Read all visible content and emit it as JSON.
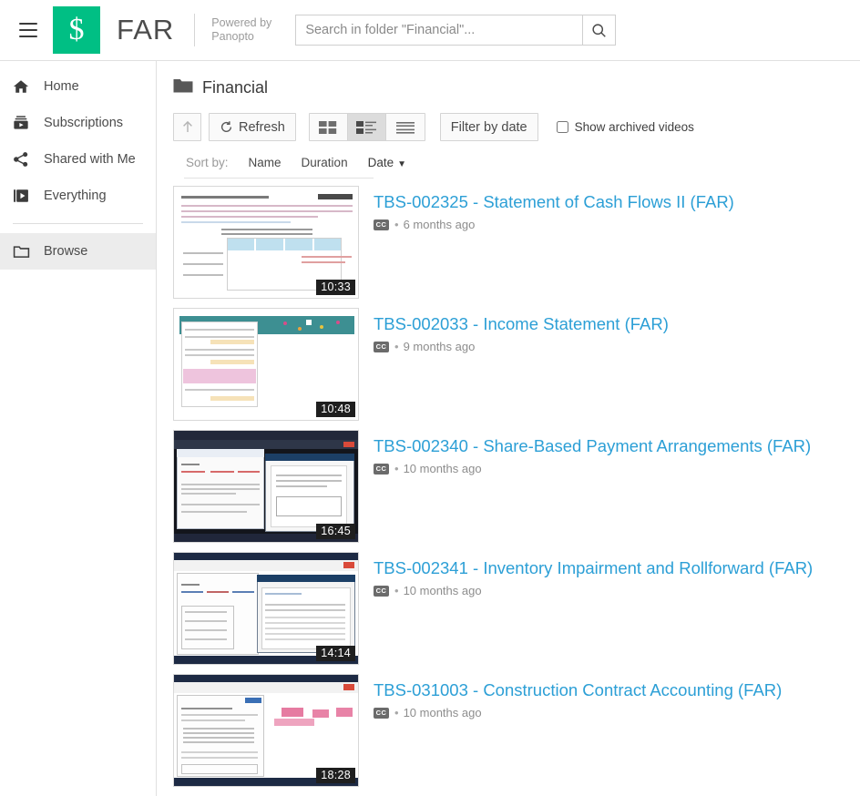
{
  "header": {
    "menu_icon": "hamburger-icon",
    "logo_glyph": "$",
    "site_title": "FAR",
    "powered_line1": "Powered by",
    "powered_line2": "Panopto",
    "search_placeholder": "Search in folder \"Financial\"...",
    "search_value": "",
    "search_icon": "search-icon"
  },
  "sidebar": {
    "items": [
      {
        "label": "Home",
        "icon": "home-icon",
        "active": false
      },
      {
        "label": "Subscriptions",
        "icon": "subscriptions-icon",
        "active": false
      },
      {
        "label": "Shared with Me",
        "icon": "share-icon",
        "active": false
      },
      {
        "label": "Everything",
        "icon": "everything-icon",
        "active": false
      },
      {
        "label": "Browse",
        "icon": "folder-icon",
        "active": true
      }
    ]
  },
  "main": {
    "folder_icon": "folder-icon",
    "folder_title": "Financial",
    "toolbar": {
      "up_label": "↑",
      "refresh_label": "Refresh",
      "refresh_icon": "refresh-icon",
      "view_grid": "grid-view",
      "view_detail": "detail-view",
      "view_list": "list-view",
      "selected_view": "detail-view",
      "filter_label": "Filter by date",
      "archived_label": "Show archived videos",
      "archived_checked": false
    },
    "sort": {
      "label": "Sort by:",
      "options": [
        "Name",
        "Duration",
        "Date"
      ],
      "active": "Date",
      "caret": "▼"
    },
    "videos": [
      {
        "title": "TBS-002325 - Statement of Cash Flows II (FAR)",
        "duration": "10:33",
        "cc": "CC",
        "dot": "•",
        "age": "6 months ago",
        "thumb_style": "doc-white"
      },
      {
        "title": "TBS-002033 - Income Statement (FAR)",
        "duration": "10:48",
        "cc": "CC",
        "dot": "•",
        "age": "9 months ago",
        "thumb_style": "spreadsheet-teal"
      },
      {
        "title": "TBS-002340 - Share-Based Payment Arrangements (FAR)",
        "duration": "16:45",
        "cc": "CC",
        "dot": "•",
        "age": "10 months ago",
        "thumb_style": "desktop-dual"
      },
      {
        "title": "TBS-002341 - Inventory Impairment and Rollforward (FAR)",
        "duration": "14:14",
        "cc": "CC",
        "dot": "•",
        "age": "10 months ago",
        "thumb_style": "desktop-dialog"
      },
      {
        "title": "TBS-031003 - Construction Contract Accounting (FAR)",
        "duration": "18:28",
        "cc": "CC",
        "dot": "•",
        "age": "10 months ago",
        "thumb_style": "desktop-annot"
      }
    ]
  },
  "colors": {
    "brand_green": "#00bf84",
    "link_blue": "#2c9fd6",
    "text_dark": "#3a3a3a",
    "muted": "#8d8d8d"
  }
}
